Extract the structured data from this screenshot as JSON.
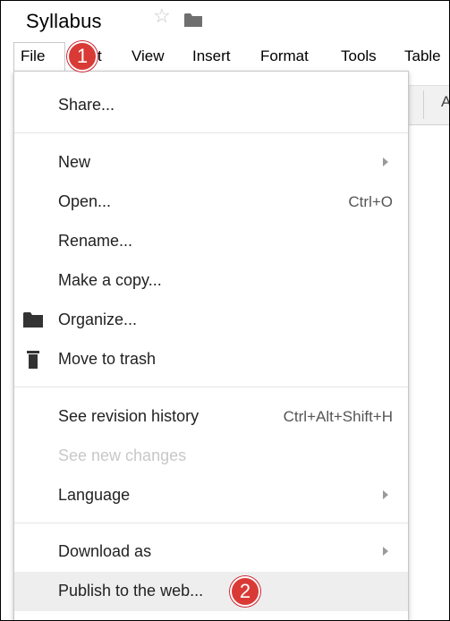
{
  "document": {
    "title": "Syllabus"
  },
  "menubar": {
    "items": [
      {
        "label": "File"
      },
      {
        "label": "t"
      },
      {
        "label": "View"
      },
      {
        "label": "Insert"
      },
      {
        "label": "Format"
      },
      {
        "label": "Tools"
      },
      {
        "label": "Table"
      }
    ]
  },
  "toolbar": {
    "partial_label": "A"
  },
  "file_menu": {
    "items": [
      {
        "label": "Share..."
      },
      {
        "label": "New",
        "submenu": true
      },
      {
        "label": "Open...",
        "shortcut": "Ctrl+O"
      },
      {
        "label": "Rename..."
      },
      {
        "label": "Make a copy..."
      },
      {
        "label": "Organize...",
        "icon": "folder-icon"
      },
      {
        "label": "Move to trash",
        "icon": "trash-icon"
      },
      {
        "label": "See revision history",
        "shortcut": "Ctrl+Alt+Shift+H"
      },
      {
        "label": "See new changes",
        "disabled": true
      },
      {
        "label": "Language",
        "submenu": true
      },
      {
        "label": "Download as",
        "submenu": true
      },
      {
        "label": "Publish to the web...",
        "highlighted": true
      }
    ]
  },
  "annotations": {
    "step1": "1",
    "step2": "2"
  },
  "colors": {
    "badge": "#d93a36",
    "highlight": "#eeeeee",
    "disabled_text": "#c8c8c8"
  }
}
